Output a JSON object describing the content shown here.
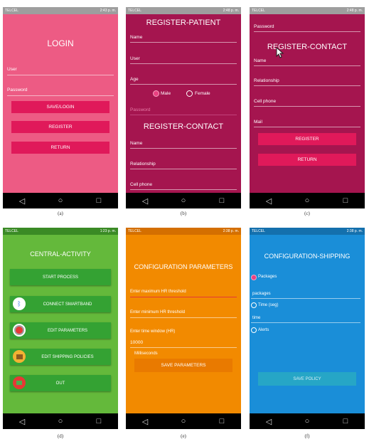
{
  "status": {
    "carrier": "TELCEL",
    "a_right": "2:43 p. m.",
    "b_right": "2:48 p. m.",
    "c_right": "2:48 p. m.",
    "d_right": "1:23 p. m.",
    "e_right": "2:38 p. m.",
    "f_right": "2:38 p. m."
  },
  "nav": {
    "back": "◁",
    "home": "○",
    "recent": "□"
  },
  "captions": [
    "(a)",
    "(b)",
    "(c)",
    "(d)",
    "(e)",
    "(f)"
  ],
  "colors": {
    "a": "#ed5b84",
    "bc": "#a5154f",
    "d": "#64b93b",
    "e": "#f28a00",
    "f": "#1a8ed8"
  },
  "login": {
    "title": "LOGIN",
    "user": "User",
    "password": "Password",
    "save": "SAVE/LOGIN",
    "register": "REGISTER",
    "return": "RETURN"
  },
  "reg_patient": {
    "title": "REGISTER-PATIENT",
    "name": "Name",
    "user": "User",
    "age": "Age",
    "male": "Male",
    "female": "Female",
    "password": "Password",
    "contact_title": "REGISTER-CONTACT",
    "c_name": "Name",
    "relationship": "Relationship",
    "cell": "Cell phone"
  },
  "reg_contact": {
    "password": "Password",
    "title": "REGISTER-CONTACT",
    "name": "Name",
    "relationship": "Relationship",
    "cell": "Cell phone",
    "mail": "Mail",
    "register": "REGISTER",
    "return": "RETURN"
  },
  "central": {
    "title": "CENTRAL-ACTIVITY",
    "start": "START PROCESS",
    "connect": "CONNECT SMARTBAND",
    "edit_params": "EDIT PARAMETERS",
    "edit_shipping": "EDIT SHIPPING POLICIES",
    "out": "OUT"
  },
  "config": {
    "title": "CONFIGURATION PARAMETERS",
    "max_hr": "Enter maximum HR threshold",
    "min_hr": "Enter minimum HR threshold",
    "time_window": "Enter time window (HR)",
    "time_value": "10000",
    "ms": "Milliseconds",
    "save": "SAVE PARAMETERS"
  },
  "shipping": {
    "title": "CONFIGURATION-SHIPPING",
    "packages": "Packages",
    "packages_input": "packages",
    "time_seg": "Time (seg)",
    "time_input": "time",
    "alerts": "Alerts",
    "save": "SAVE POLICY"
  }
}
